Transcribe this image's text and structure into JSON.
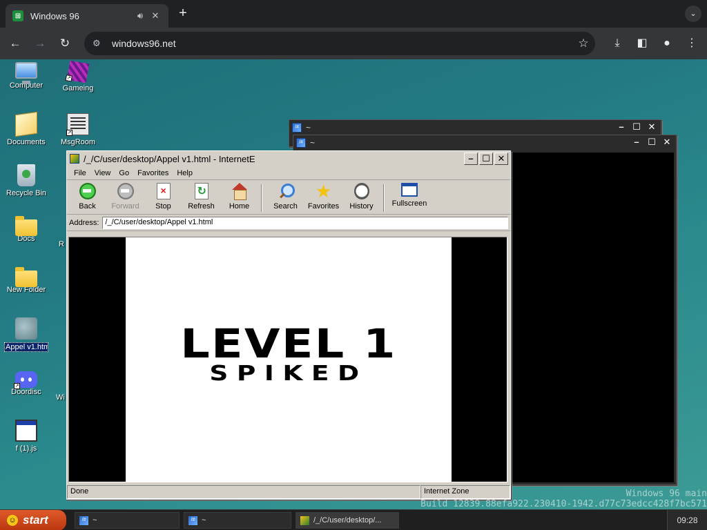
{
  "chrome": {
    "tab_title": "Windows 96",
    "tab_favicon": "⊞",
    "url": "windows96.net"
  },
  "desktop": {
    "icons": [
      {
        "label": "Computer"
      },
      {
        "label": "Gameing"
      },
      {
        "label": "Documents"
      },
      {
        "label": "MsgRoom"
      },
      {
        "label": "Recycle Bin"
      },
      {
        "label": "Docs"
      },
      {
        "label": "New Folder"
      },
      {
        "label": "Appel v1.html"
      },
      {
        "label": "Doordisc"
      },
      {
        "label": "f (1).js"
      }
    ],
    "partial_labels": [
      "R",
      "Wi"
    ]
  },
  "windows": {
    "terminal_back_title": "~",
    "terminal_front_title": "~",
    "terminal_icon": "/#"
  },
  "browser": {
    "title": "/_/C/user/desktop/Appel v1.html - InternetE",
    "menu": [
      "File",
      "View",
      "Go",
      "Favorites",
      "Help"
    ],
    "toolbar": {
      "back": "Back",
      "forward": "Forward",
      "stop": "Stop",
      "refresh": "Refresh",
      "home": "Home",
      "search": "Search",
      "favorites": "Favorites",
      "history": "History",
      "fullscreen": "Fullscreen"
    },
    "address_label": "Address:",
    "address_value": "/_/C/user/desktop/Appel v1.html",
    "status_left": "Done",
    "status_zone": "Internet Zone"
  },
  "game": {
    "level_title": "LEVEL 1",
    "level_subtitle": "SPIKED"
  },
  "watermark": {
    "line1": "Windows 96 main",
    "line2": "Build 12839.88efa922.230410-1942.d77c73edcc428f7bc571"
  },
  "taskbar": {
    "start_label": "start",
    "tasks": [
      "~",
      "~",
      "/_/C/user/desktop/..."
    ],
    "clock": "09:28"
  }
}
